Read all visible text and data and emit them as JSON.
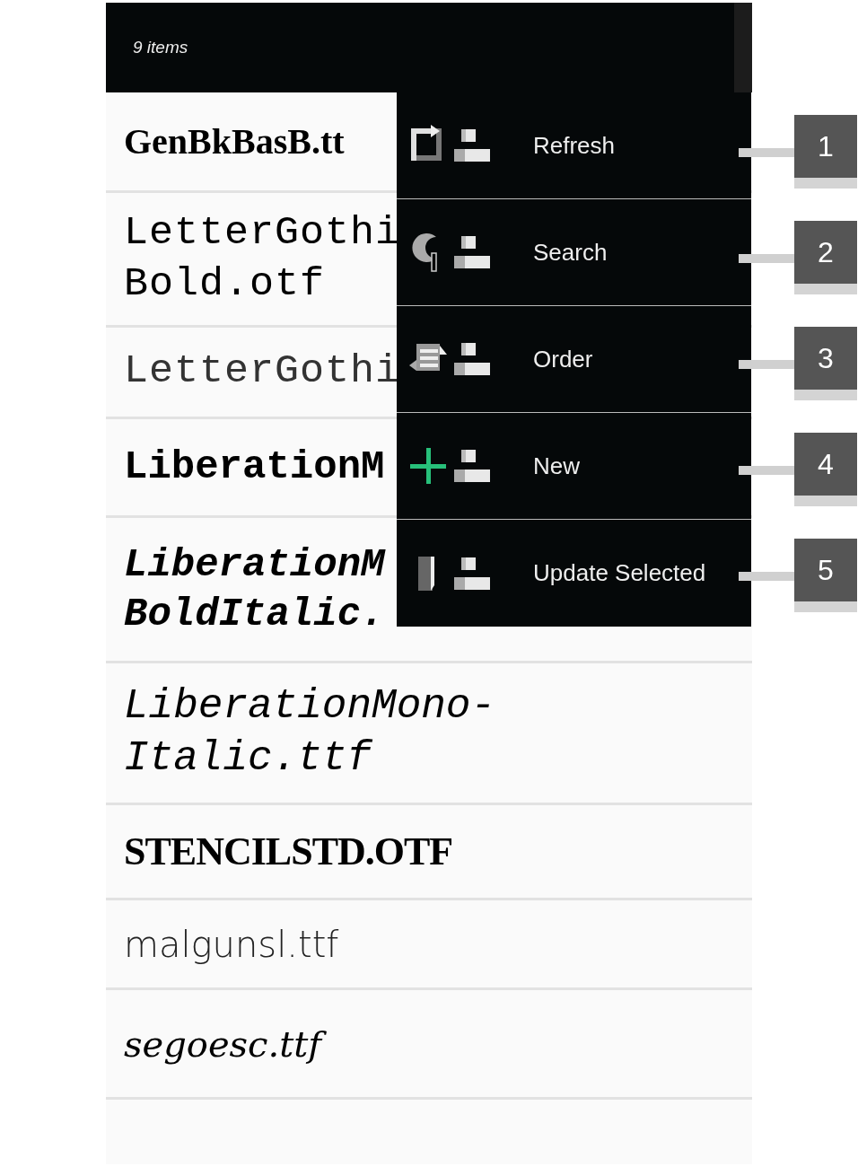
{
  "header": {
    "count": "9 items"
  },
  "files": [
    {
      "kind": "serif-bold",
      "lines": [
        "GenBkBasB.tt"
      ]
    },
    {
      "kind": "mono",
      "lines": [
        "LetterGothi",
        "Bold.otf"
      ]
    },
    {
      "kind": "mono-light",
      "lines": [
        "LetterGothi"
      ]
    },
    {
      "kind": "mono-bold",
      "lines": [
        "LiberationM"
      ]
    },
    {
      "kind": "mono-bold-italic",
      "lines": [
        "LiberationM",
        "BoldItalic."
      ]
    },
    {
      "kind": "mono-italic",
      "lines": [
        "LiberationMono-",
        "Italic.ttf"
      ]
    },
    {
      "kind": "stencil",
      "lines": [
        "STENCILSTD.OTF"
      ]
    },
    {
      "kind": "sans-light",
      "lines": [
        "malgunsl.ttf"
      ]
    },
    {
      "kind": "script",
      "lines": [
        "segoesc.ttf"
      ]
    }
  ],
  "menu": [
    {
      "kind": "refresh",
      "label": "Refresh",
      "callout": "1"
    },
    {
      "kind": "search",
      "label": "Search",
      "callout": "2"
    },
    {
      "kind": "order",
      "label": "Order",
      "callout": "3"
    },
    {
      "kind": "new",
      "label": "New",
      "callout": "4"
    },
    {
      "kind": "update",
      "label": "Update Selected",
      "callout": "5"
    }
  ]
}
